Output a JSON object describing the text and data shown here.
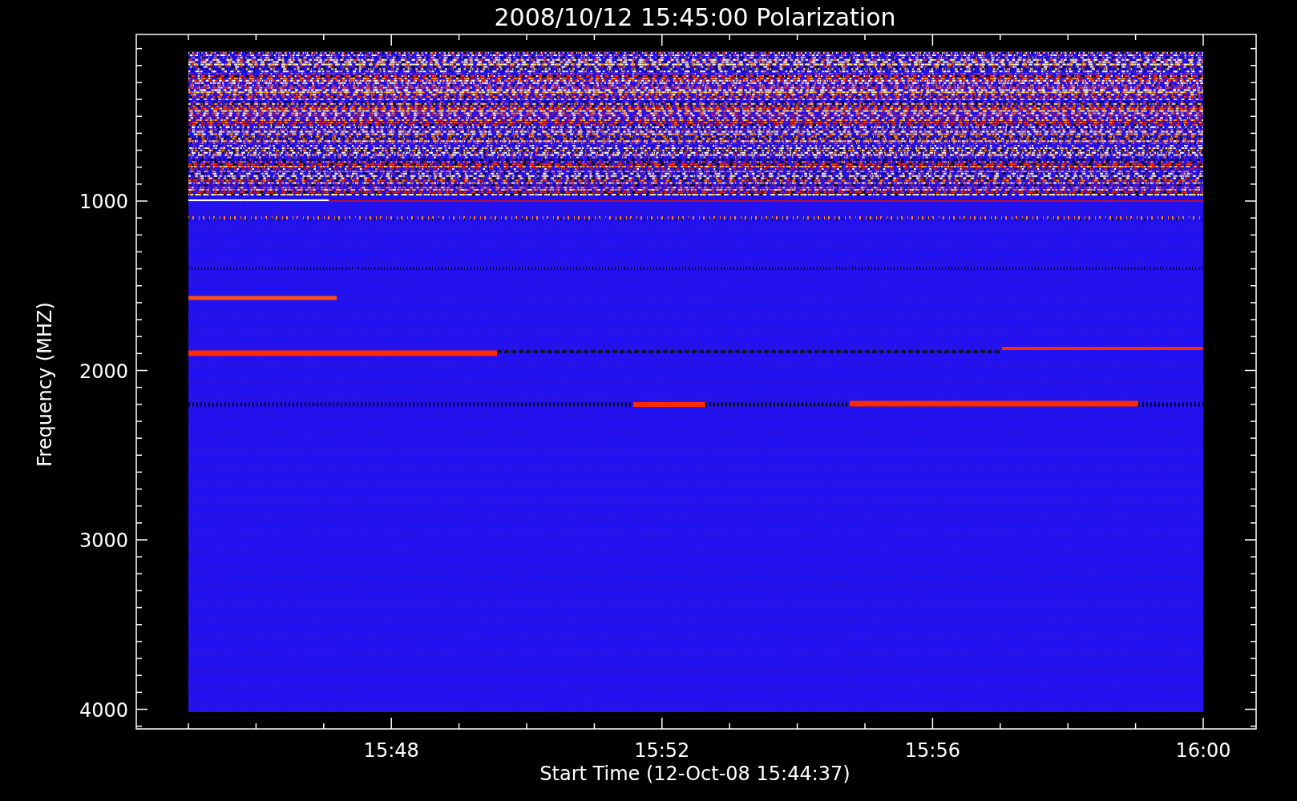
{
  "plot": {
    "title": "2008/10/12 15:45:00 Polarization",
    "xlabel": "Start Time (12-Oct-08 15:44:37)",
    "ylabel": "Frequency (MHZ)",
    "xtick_labels": [
      "15:48",
      "15:52",
      "15:56",
      "16:00"
    ],
    "ytick_labels": [
      "1000",
      "2000",
      "3000",
      "4000"
    ]
  }
}
